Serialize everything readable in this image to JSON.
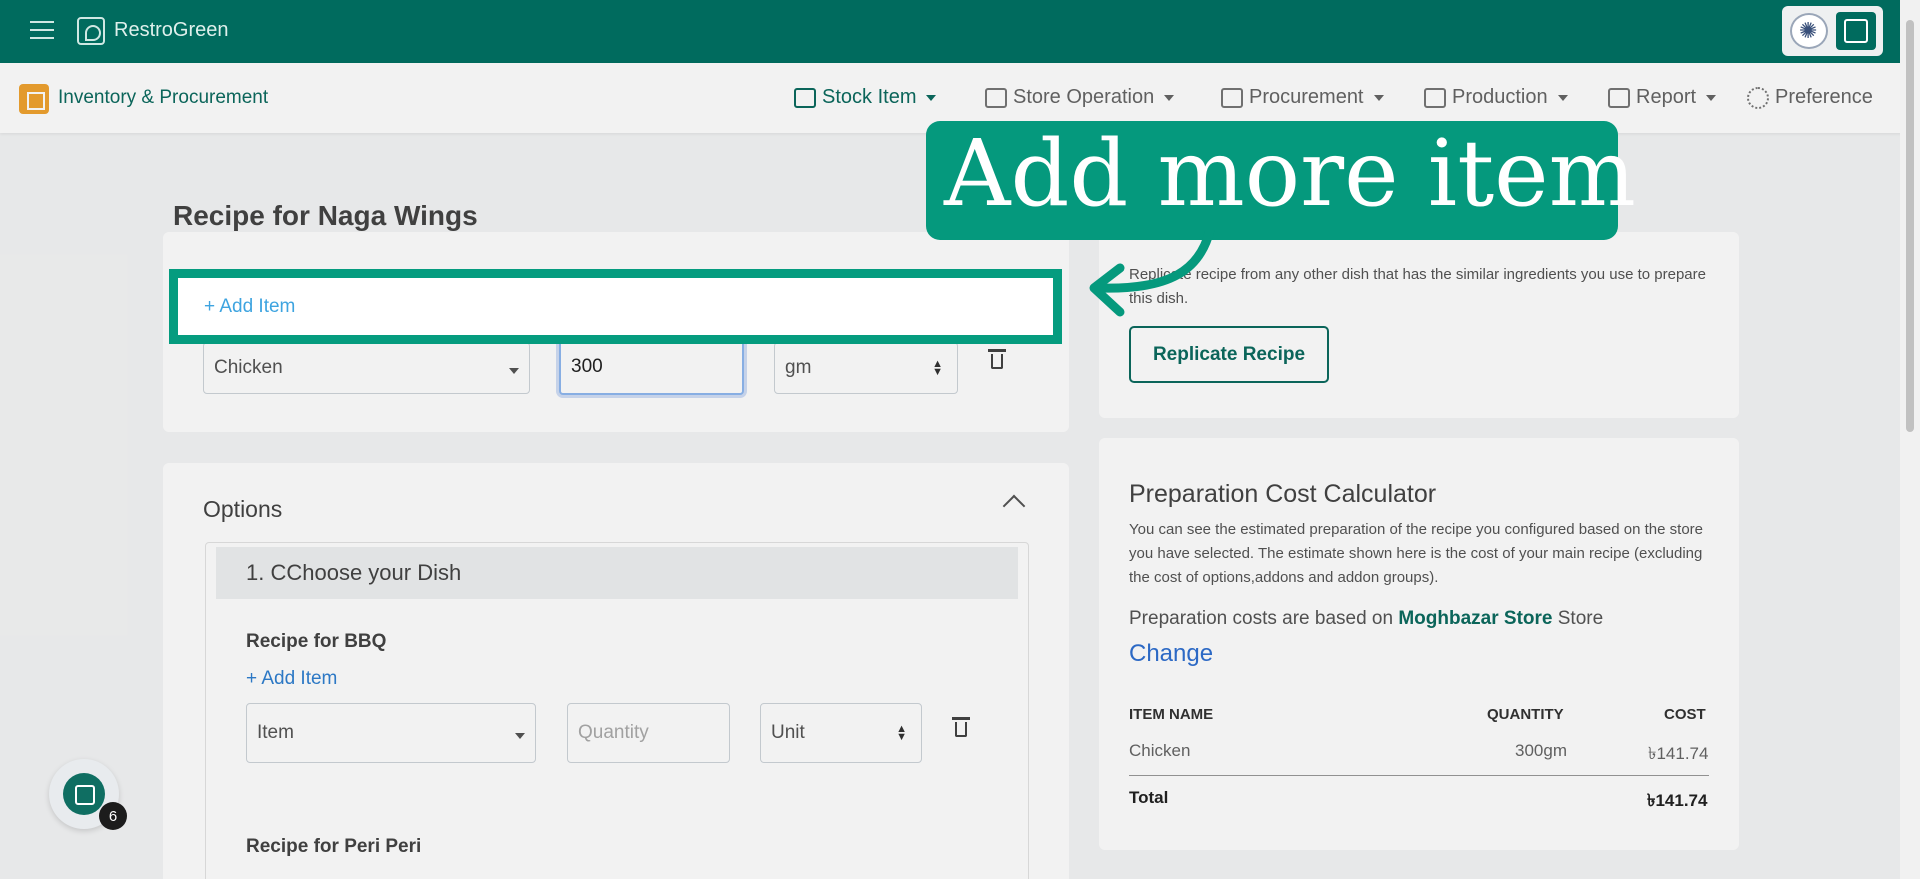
{
  "topbar": {
    "brand": "RestroGreen"
  },
  "subnav": {
    "module_title": "Inventory & Procurement",
    "items": [
      {
        "label": "Stock Item"
      },
      {
        "label": "Store Operation"
      },
      {
        "label": "Procurement"
      },
      {
        "label": "Production"
      },
      {
        "label": "Report"
      },
      {
        "label": "Preference"
      }
    ]
  },
  "recipe": {
    "title": "Recipe for Naga Wings",
    "add_item_label": "+ Add Item",
    "item_value": "Chicken",
    "quantity_value": "300",
    "unit_value": "gm"
  },
  "options": {
    "title": "Options",
    "group_title": "1. CChoose your Dish",
    "bbq": {
      "title": "Recipe for BBQ",
      "add_item_label": "+ Add Item",
      "item_placeholder": "Item",
      "quantity_placeholder": "Quantity",
      "unit_placeholder": "Unit"
    },
    "periperi": {
      "title": "Recipe for Peri Peri"
    }
  },
  "replicate": {
    "description": "Replicate recipe from any other dish that has the similar ingredients you use to prepare this dish.",
    "button_label": "Replicate Recipe"
  },
  "calculator": {
    "title": "Preparation Cost Calculator",
    "description": "You can see the estimated preparation of the recipe you configured based on the store you have selected. The estimate shown here is the cost of your main recipe (excluding the cost of options,addons and addon groups).",
    "store_prefix": "Preparation costs are based on",
    "store_name": "Moghbazar Store",
    "store_suffix": "Store",
    "change_label": "Change",
    "headers": {
      "name": "ITEM NAME",
      "quantity": "QUANTITY",
      "cost": "COST"
    },
    "rows": [
      {
        "name": "Chicken",
        "quantity": "300gm",
        "cost": "৳141.74"
      }
    ],
    "total_label": "Total",
    "total_value": "৳141.74"
  },
  "tutorial": {
    "callout_text": "Add more item",
    "highlight_label": "+ Add Item"
  },
  "fab": {
    "badge_count": "6"
  },
  "colors": {
    "brand": "#006b5e",
    "accent": "#05997d",
    "link": "#2f7fd0"
  }
}
